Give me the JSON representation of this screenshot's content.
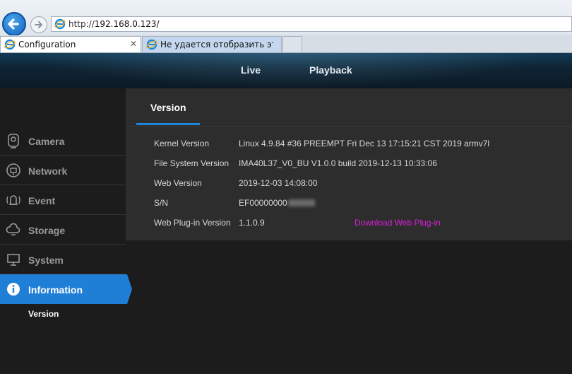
{
  "browser": {
    "url_prefix": "http://",
    "url_host": "192.168.0.123/",
    "tabs": [
      {
        "label": "Configuration"
      },
      {
        "label": "Не удается отобразить эту ст..."
      }
    ],
    "close_glyph": "✕"
  },
  "app": {
    "nav": [
      "Live",
      "Playback"
    ],
    "sidebar": [
      {
        "label": "Camera",
        "icon": "camera-icon"
      },
      {
        "label": "Network",
        "icon": "network-icon"
      },
      {
        "label": "Event",
        "icon": "event-icon"
      },
      {
        "label": "Storage",
        "icon": "storage-icon"
      },
      {
        "label": "System",
        "icon": "system-icon"
      },
      {
        "label": "Information",
        "icon": "info-icon"
      }
    ],
    "sub_item": "Version",
    "accent": "#1f7fd6"
  },
  "content": {
    "tab_title": "Version",
    "rows": [
      {
        "label": "Kernel Version",
        "value": "Linux 4.9.84 #36 PREEMPT Fri Dec 13 17:15:21 CST 2019 armv7l"
      },
      {
        "label": "File System Version",
        "value": "IMA40L37_V0_BU V1.0.0 build 2019-12-13 10:33:06"
      },
      {
        "label": "Web Version",
        "value": "2019-12-03 14:08:00"
      },
      {
        "label": "S/N",
        "value": "EF00000000"
      },
      {
        "label": "Web Plug-in Version",
        "value": "1.1.0.9"
      }
    ],
    "download_link": "Download Web Plug-in",
    "link_color": "#d81fd8"
  }
}
